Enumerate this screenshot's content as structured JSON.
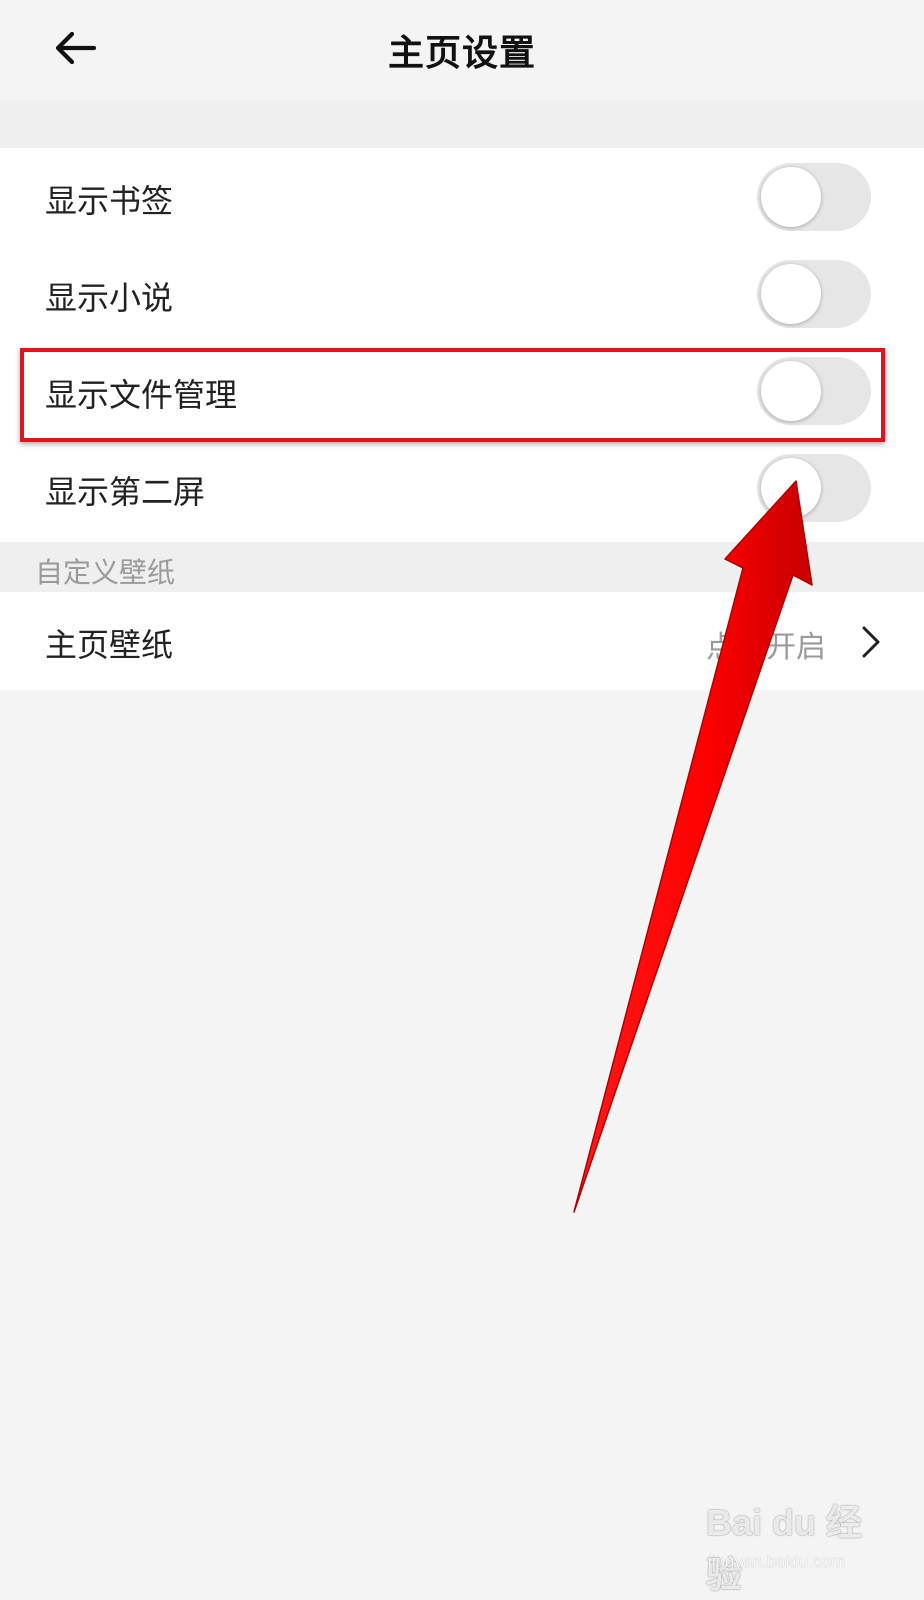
{
  "header": {
    "title": "主页设置",
    "back_icon": "arrow-left-icon"
  },
  "toggles": [
    {
      "label": "显示书签",
      "on": false
    },
    {
      "label": "显示小说",
      "on": false
    },
    {
      "label": "显示文件管理",
      "on": false
    },
    {
      "label": "显示第二屏",
      "on": false
    }
  ],
  "section": {
    "label": "自定义壁纸"
  },
  "wallpaper": {
    "label": "主页壁纸",
    "value": "点击开启",
    "chevron_icon": "chevron-right-icon"
  },
  "annotation": {
    "highlight_color": "#e1141c",
    "arrow_color": "#ff0000"
  },
  "watermark": {
    "main": "Bai du 经验",
    "sub": "jingyan.baidu.com"
  }
}
